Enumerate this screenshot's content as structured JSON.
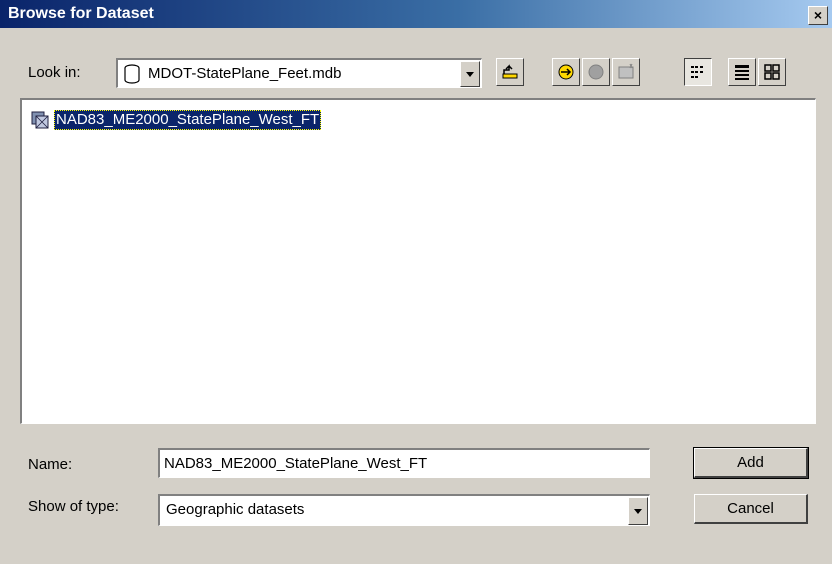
{
  "window": {
    "title": "Browse for Dataset",
    "close_label": "×"
  },
  "look_in": {
    "label": "Look in:",
    "value": "MDOT-StatePlane_Feet.mdb",
    "icon": "database-icon"
  },
  "toolbar": {
    "buttons": [
      "up-one-level",
      "connect-to-folder",
      "disconnect-from-folder",
      "new-geodatabase",
      "list-view",
      "details-view",
      "thumbnails-view"
    ]
  },
  "list": {
    "items": [
      {
        "label": "NAD83_ME2000_StatePlane_West_FT",
        "icon": "feature-dataset-icon",
        "selected": true
      }
    ]
  },
  "name": {
    "label": "Name:",
    "value": "NAD83_ME2000_StatePlane_West_FT"
  },
  "show_type": {
    "label": "Show of type:",
    "value": "Geographic datasets"
  },
  "buttons": {
    "add": "Add",
    "cancel": "Cancel"
  },
  "colors": {
    "title_start": "#0a246a",
    "title_end": "#a6caf0",
    "selection": "#0a246a",
    "face": "#d4d0c8"
  }
}
